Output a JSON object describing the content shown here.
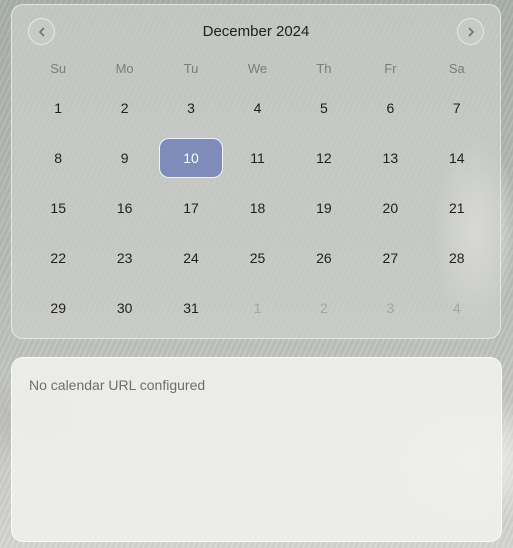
{
  "calendar": {
    "month_title": "December 2024",
    "prev_icon": "chevron-left-icon",
    "next_icon": "chevron-right-icon",
    "weekdays": [
      "Su",
      "Mo",
      "Tu",
      "We",
      "Th",
      "Fr",
      "Sa"
    ],
    "selected_day": "10",
    "selected_color": "#7f8bb9",
    "days": [
      {
        "label": "1",
        "state": "current"
      },
      {
        "label": "2",
        "state": "current"
      },
      {
        "label": "3",
        "state": "current"
      },
      {
        "label": "4",
        "state": "current"
      },
      {
        "label": "5",
        "state": "current"
      },
      {
        "label": "6",
        "state": "current"
      },
      {
        "label": "7",
        "state": "current"
      },
      {
        "label": "8",
        "state": "current"
      },
      {
        "label": "9",
        "state": "current"
      },
      {
        "label": "10",
        "state": "selected"
      },
      {
        "label": "11",
        "state": "current"
      },
      {
        "label": "12",
        "state": "current"
      },
      {
        "label": "13",
        "state": "current"
      },
      {
        "label": "14",
        "state": "current"
      },
      {
        "label": "15",
        "state": "current"
      },
      {
        "label": "16",
        "state": "current"
      },
      {
        "label": "17",
        "state": "current"
      },
      {
        "label": "18",
        "state": "current"
      },
      {
        "label": "19",
        "state": "current"
      },
      {
        "label": "20",
        "state": "current"
      },
      {
        "label": "21",
        "state": "current"
      },
      {
        "label": "22",
        "state": "current"
      },
      {
        "label": "23",
        "state": "current"
      },
      {
        "label": "24",
        "state": "current"
      },
      {
        "label": "25",
        "state": "current"
      },
      {
        "label": "26",
        "state": "current"
      },
      {
        "label": "27",
        "state": "current"
      },
      {
        "label": "28",
        "state": "current"
      },
      {
        "label": "29",
        "state": "current"
      },
      {
        "label": "30",
        "state": "current"
      },
      {
        "label": "31",
        "state": "current"
      },
      {
        "label": "1",
        "state": "next-month"
      },
      {
        "label": "2",
        "state": "next-month"
      },
      {
        "label": "3",
        "state": "next-month"
      },
      {
        "label": "4",
        "state": "next-month"
      }
    ]
  },
  "events": {
    "message": "No calendar URL configured"
  }
}
